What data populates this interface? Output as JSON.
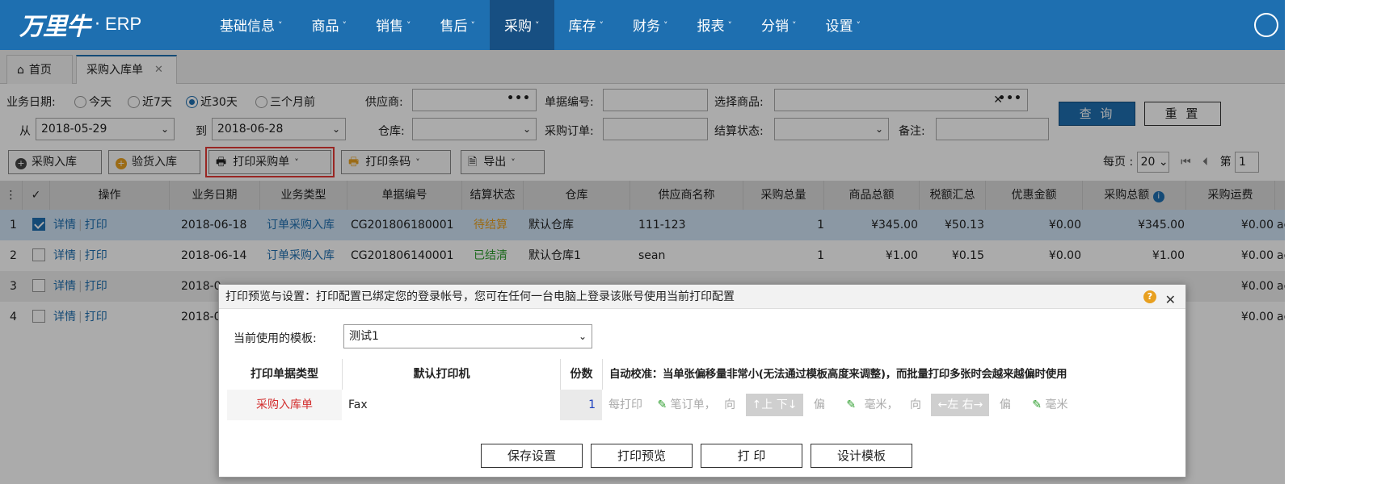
{
  "navbar": {
    "logo_cn": "万里牛",
    "logo_dot": "·",
    "logo_en": "ERP",
    "menu": [
      {
        "label": "基础信息"
      },
      {
        "label": "商品"
      },
      {
        "label": "销售"
      },
      {
        "label": "售后"
      },
      {
        "label": "采购",
        "active": true
      },
      {
        "label": "库存"
      },
      {
        "label": "财务"
      },
      {
        "label": "报表"
      },
      {
        "label": "分销"
      },
      {
        "label": "设置"
      }
    ],
    "color": "#1e6fb0"
  },
  "tabs": {
    "home": "首页",
    "active": "采购入库单"
  },
  "filters": {
    "date_label": "业务日期:",
    "date_options": [
      "今天",
      "近7天",
      "近30天",
      "三个月前"
    ],
    "date_selected": "近30天",
    "from_label": "从",
    "from_value": "2018-05-29",
    "to_label": "到",
    "to_value": "2018-06-28",
    "supplier_label": "供应商:",
    "doc_no_label": "单据编号:",
    "product_label": "选择商品:",
    "warehouse_label": "仓库:",
    "po_label": "采购订单:",
    "settle_label": "结算状态:",
    "note_label": "备注:",
    "query_button": "查 询",
    "reset_button": "重 置"
  },
  "toolbar": {
    "purchase_in": "采购入库",
    "inspect_in": "验货入库",
    "print_po": "打印采购单",
    "print_barcode": "打印条码",
    "export": "导出"
  },
  "pager": {
    "per_page_label": "每页 :",
    "per_page": "20",
    "page_label": "第",
    "page": "1"
  },
  "grid": {
    "headers": [
      "操作",
      "业务日期",
      "业务类型",
      "单据编号",
      "结算状态",
      "仓库",
      "供应商名称",
      "采购总量",
      "商品总额",
      "税额汇总",
      "优惠金额",
      "采购总额",
      "采购运费"
    ],
    "rows": [
      {
        "no": "1",
        "checked": true,
        "detail": "详情",
        "print": "打印",
        "date": "2018-06-18",
        "type": "订单采购入库",
        "doc": "CG201806180001",
        "status": "待结算",
        "warehouse": "默认仓库",
        "supplier": "111-123",
        "qty": "1",
        "goods": "¥345.00",
        "tax": "¥50.13",
        "discount": "¥0.00",
        "total": "¥345.00",
        "freight": "¥0.00",
        "extra": "ac"
      },
      {
        "no": "2",
        "checked": false,
        "detail": "详情",
        "print": "打印",
        "date": "2018-06-14",
        "type": "订单采购入库",
        "doc": "CG201806140001",
        "status": "已结清",
        "warehouse": "默认仓库1",
        "supplier": "sean",
        "qty": "1",
        "goods": "¥1.00",
        "tax": "¥0.15",
        "discount": "¥0.00",
        "total": "¥1.00",
        "freight": "¥0.00",
        "extra": "ac"
      },
      {
        "no": "3",
        "checked": false,
        "detail": "详情",
        "print": "打印",
        "date": "2018-0",
        "freight": "¥0.00",
        "extra": "ac"
      },
      {
        "no": "4",
        "checked": false,
        "detail": "详情",
        "print": "打印",
        "date": "2018-0",
        "freight": "¥0.00",
        "extra": "ac"
      }
    ]
  },
  "dialog": {
    "title": "打印预览与设置：打印配置已绑定您的登录帐号，您可在任何一台电脑上登录该账号使用当前打印配置",
    "template_label": "当前使用的模板:",
    "template_value": "测试1",
    "headers": {
      "type": "打印单据类型",
      "printer": "默认打印机",
      "copies": "份数",
      "calibration": "自动校准：当单张偏移量非常小(无法通过模板高度来调整)，而批量打印多张时会越来越偏时使用"
    },
    "row": {
      "type": "采购入库单",
      "printer": "Fax",
      "copies": "1",
      "each_print": "每打印",
      "orders_unit": "笔订单，",
      "toward": "向",
      "up_down": "↑上 下↓",
      "offset": "偏",
      "mm": "毫米，",
      "toward2": "向",
      "left_right": "←左 右→",
      "offset2": "偏",
      "mm2": "毫米"
    },
    "buttons": {
      "save": "保存设置",
      "preview": "打印预览",
      "print": "打 印",
      "design": "设计模板"
    }
  }
}
